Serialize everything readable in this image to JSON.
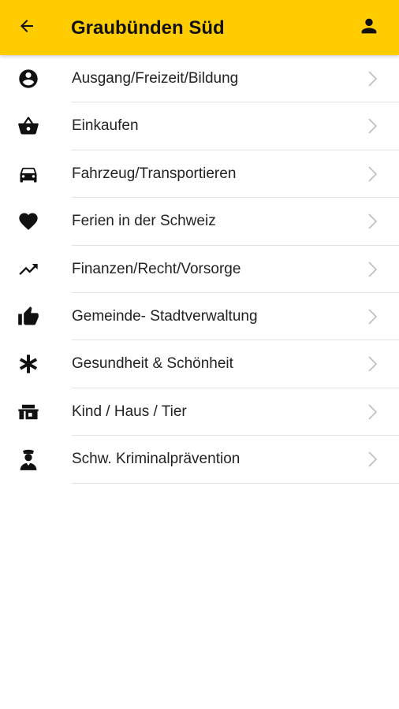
{
  "header": {
    "title": "Graubünden Süd",
    "back_icon": "arrow-left-icon",
    "profile_icon": "person-icon",
    "background_color": "#ffcc00"
  },
  "menu": {
    "items": [
      {
        "label": "Ausgang/Freizeit/Bildung",
        "icon": "account-circle-icon"
      },
      {
        "label": "Einkaufen",
        "icon": "shopping-basket-icon"
      },
      {
        "label": "Fahrzeug/Transportieren",
        "icon": "car-icon"
      },
      {
        "label": "Ferien in der Schweiz",
        "icon": "heart-icon"
      },
      {
        "label": "Finanzen/Recht/Vorsorge",
        "icon": "trending-up-icon"
      },
      {
        "label": "Gemeinde- Stadtverwaltung",
        "icon": "thumbs-up-icon"
      },
      {
        "label": "Gesundheit & Schönheit",
        "icon": "asterisk-icon"
      },
      {
        "label": "Kind / Haus / Tier",
        "icon": "house-icon"
      },
      {
        "label": "Schw. Kriminalprävention",
        "icon": "police-officer-icon"
      }
    ]
  }
}
